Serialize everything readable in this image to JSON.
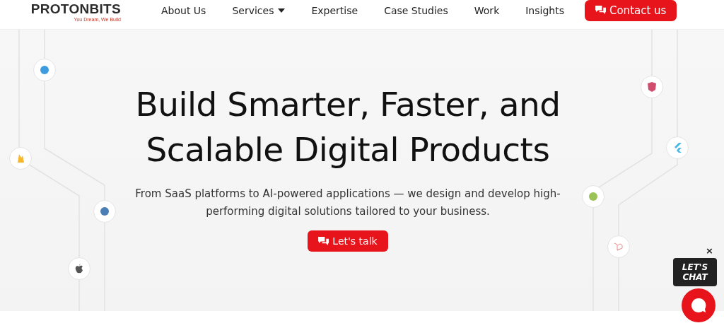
{
  "logo": {
    "name": "PROTONBITS",
    "tagline": "You Dream, We Build"
  },
  "nav": [
    {
      "label": "About Us",
      "dropdown": false
    },
    {
      "label": "Services",
      "dropdown": true
    },
    {
      "label": "Expertise",
      "dropdown": false
    },
    {
      "label": "Case Studies",
      "dropdown": false
    },
    {
      "label": "Work",
      "dropdown": false
    },
    {
      "label": "Insights",
      "dropdown": false
    }
  ],
  "contact_button": "Contact us",
  "hero": {
    "title_lines": [
      "Build Smarter, Faster, and",
      "Scalable Digital Products"
    ],
    "subtitle": "From SaaS platforms to AI-powered applications — we design and develop high-performing digital solutions tailored to your business.",
    "cta": "Let's talk"
  },
  "chat_widget": {
    "close": "×",
    "bubble_lines": [
      "LET'S",
      "CHAT"
    ]
  }
}
